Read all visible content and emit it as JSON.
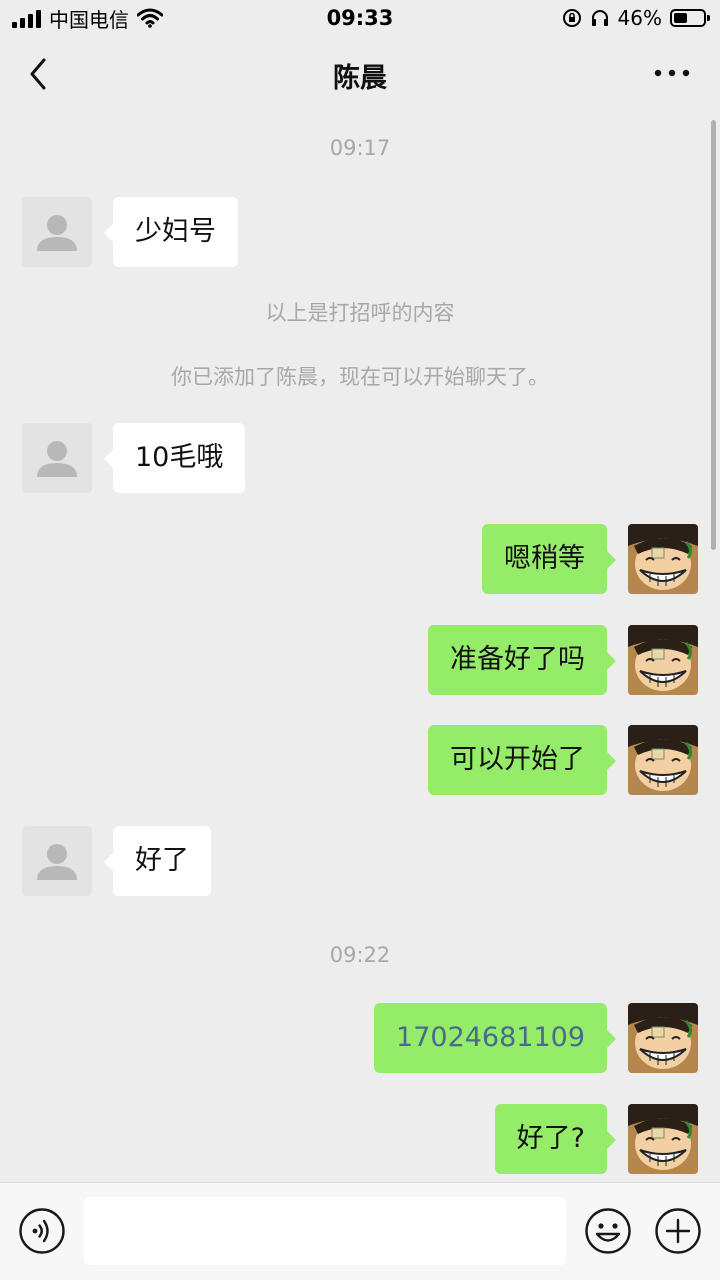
{
  "status_bar": {
    "carrier": "中国电信",
    "time": "09:33",
    "battery_percent": "46%",
    "battery_level": 0.46
  },
  "header": {
    "title": "陈晨"
  },
  "chat": {
    "timestamps": [
      "09:17",
      "09:22"
    ],
    "system_notes": [
      "以上是打招呼的内容",
      "你已添加了陈晨，现在可以开始聊天了。"
    ],
    "messages": [
      {
        "side": "left",
        "text": "少妇号"
      },
      {
        "side": "left",
        "text": "10毛哦"
      },
      {
        "side": "right",
        "text": "嗯稍等"
      },
      {
        "side": "right",
        "text": "准备好了吗"
      },
      {
        "side": "right",
        "text": "可以开始了"
      },
      {
        "side": "left",
        "text": "好了"
      },
      {
        "side": "right",
        "text": "17024681109"
      },
      {
        "side": "right",
        "text": "好了?"
      }
    ]
  },
  "input_bar": {
    "placeholder": ""
  },
  "colors": {
    "background": "#ededed",
    "my_bubble": "#95ec69",
    "their_bubble": "#ffffff",
    "phone_link": "#4a6a8c"
  },
  "icons": {
    "back": "chevron-left-icon",
    "more": "more-dots-icon",
    "voice": "voice-icon",
    "emoji": "emoji-icon",
    "plus": "plus-icon"
  }
}
